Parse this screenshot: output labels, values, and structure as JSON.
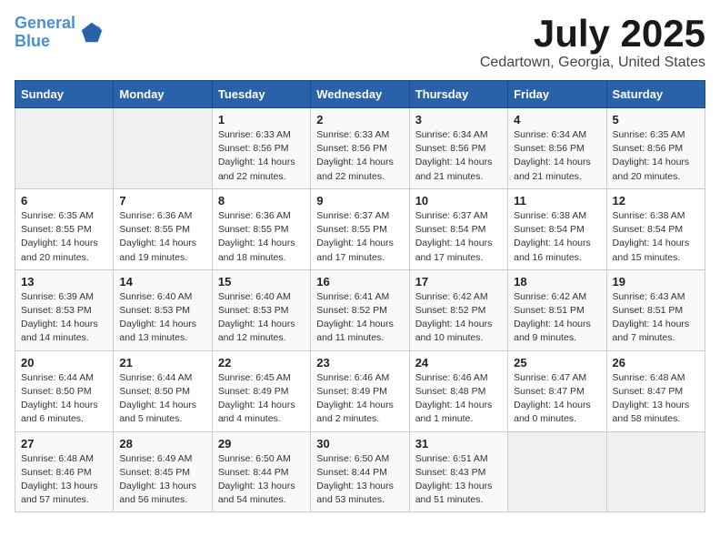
{
  "header": {
    "logo_line1": "General",
    "logo_line2": "Blue",
    "month": "July 2025",
    "location": "Cedartown, Georgia, United States"
  },
  "days_of_week": [
    "Sunday",
    "Monday",
    "Tuesday",
    "Wednesday",
    "Thursday",
    "Friday",
    "Saturday"
  ],
  "weeks": [
    [
      {
        "day": "",
        "info": ""
      },
      {
        "day": "",
        "info": ""
      },
      {
        "day": "1",
        "info": "Sunrise: 6:33 AM\nSunset: 8:56 PM\nDaylight: 14 hours and 22 minutes."
      },
      {
        "day": "2",
        "info": "Sunrise: 6:33 AM\nSunset: 8:56 PM\nDaylight: 14 hours and 22 minutes."
      },
      {
        "day": "3",
        "info": "Sunrise: 6:34 AM\nSunset: 8:56 PM\nDaylight: 14 hours and 21 minutes."
      },
      {
        "day": "4",
        "info": "Sunrise: 6:34 AM\nSunset: 8:56 PM\nDaylight: 14 hours and 21 minutes."
      },
      {
        "day": "5",
        "info": "Sunrise: 6:35 AM\nSunset: 8:56 PM\nDaylight: 14 hours and 20 minutes."
      }
    ],
    [
      {
        "day": "6",
        "info": "Sunrise: 6:35 AM\nSunset: 8:55 PM\nDaylight: 14 hours and 20 minutes."
      },
      {
        "day": "7",
        "info": "Sunrise: 6:36 AM\nSunset: 8:55 PM\nDaylight: 14 hours and 19 minutes."
      },
      {
        "day": "8",
        "info": "Sunrise: 6:36 AM\nSunset: 8:55 PM\nDaylight: 14 hours and 18 minutes."
      },
      {
        "day": "9",
        "info": "Sunrise: 6:37 AM\nSunset: 8:55 PM\nDaylight: 14 hours and 17 minutes."
      },
      {
        "day": "10",
        "info": "Sunrise: 6:37 AM\nSunset: 8:54 PM\nDaylight: 14 hours and 17 minutes."
      },
      {
        "day": "11",
        "info": "Sunrise: 6:38 AM\nSunset: 8:54 PM\nDaylight: 14 hours and 16 minutes."
      },
      {
        "day": "12",
        "info": "Sunrise: 6:38 AM\nSunset: 8:54 PM\nDaylight: 14 hours and 15 minutes."
      }
    ],
    [
      {
        "day": "13",
        "info": "Sunrise: 6:39 AM\nSunset: 8:53 PM\nDaylight: 14 hours and 14 minutes."
      },
      {
        "day": "14",
        "info": "Sunrise: 6:40 AM\nSunset: 8:53 PM\nDaylight: 14 hours and 13 minutes."
      },
      {
        "day": "15",
        "info": "Sunrise: 6:40 AM\nSunset: 8:53 PM\nDaylight: 14 hours and 12 minutes."
      },
      {
        "day": "16",
        "info": "Sunrise: 6:41 AM\nSunset: 8:52 PM\nDaylight: 14 hours and 11 minutes."
      },
      {
        "day": "17",
        "info": "Sunrise: 6:42 AM\nSunset: 8:52 PM\nDaylight: 14 hours and 10 minutes."
      },
      {
        "day": "18",
        "info": "Sunrise: 6:42 AM\nSunset: 8:51 PM\nDaylight: 14 hours and 9 minutes."
      },
      {
        "day": "19",
        "info": "Sunrise: 6:43 AM\nSunset: 8:51 PM\nDaylight: 14 hours and 7 minutes."
      }
    ],
    [
      {
        "day": "20",
        "info": "Sunrise: 6:44 AM\nSunset: 8:50 PM\nDaylight: 14 hours and 6 minutes."
      },
      {
        "day": "21",
        "info": "Sunrise: 6:44 AM\nSunset: 8:50 PM\nDaylight: 14 hours and 5 minutes."
      },
      {
        "day": "22",
        "info": "Sunrise: 6:45 AM\nSunset: 8:49 PM\nDaylight: 14 hours and 4 minutes."
      },
      {
        "day": "23",
        "info": "Sunrise: 6:46 AM\nSunset: 8:49 PM\nDaylight: 14 hours and 2 minutes."
      },
      {
        "day": "24",
        "info": "Sunrise: 6:46 AM\nSunset: 8:48 PM\nDaylight: 14 hours and 1 minute."
      },
      {
        "day": "25",
        "info": "Sunrise: 6:47 AM\nSunset: 8:47 PM\nDaylight: 14 hours and 0 minutes."
      },
      {
        "day": "26",
        "info": "Sunrise: 6:48 AM\nSunset: 8:47 PM\nDaylight: 13 hours and 58 minutes."
      }
    ],
    [
      {
        "day": "27",
        "info": "Sunrise: 6:48 AM\nSunset: 8:46 PM\nDaylight: 13 hours and 57 minutes."
      },
      {
        "day": "28",
        "info": "Sunrise: 6:49 AM\nSunset: 8:45 PM\nDaylight: 13 hours and 56 minutes."
      },
      {
        "day": "29",
        "info": "Sunrise: 6:50 AM\nSunset: 8:44 PM\nDaylight: 13 hours and 54 minutes."
      },
      {
        "day": "30",
        "info": "Sunrise: 6:50 AM\nSunset: 8:44 PM\nDaylight: 13 hours and 53 minutes."
      },
      {
        "day": "31",
        "info": "Sunrise: 6:51 AM\nSunset: 8:43 PM\nDaylight: 13 hours and 51 minutes."
      },
      {
        "day": "",
        "info": ""
      },
      {
        "day": "",
        "info": ""
      }
    ]
  ]
}
